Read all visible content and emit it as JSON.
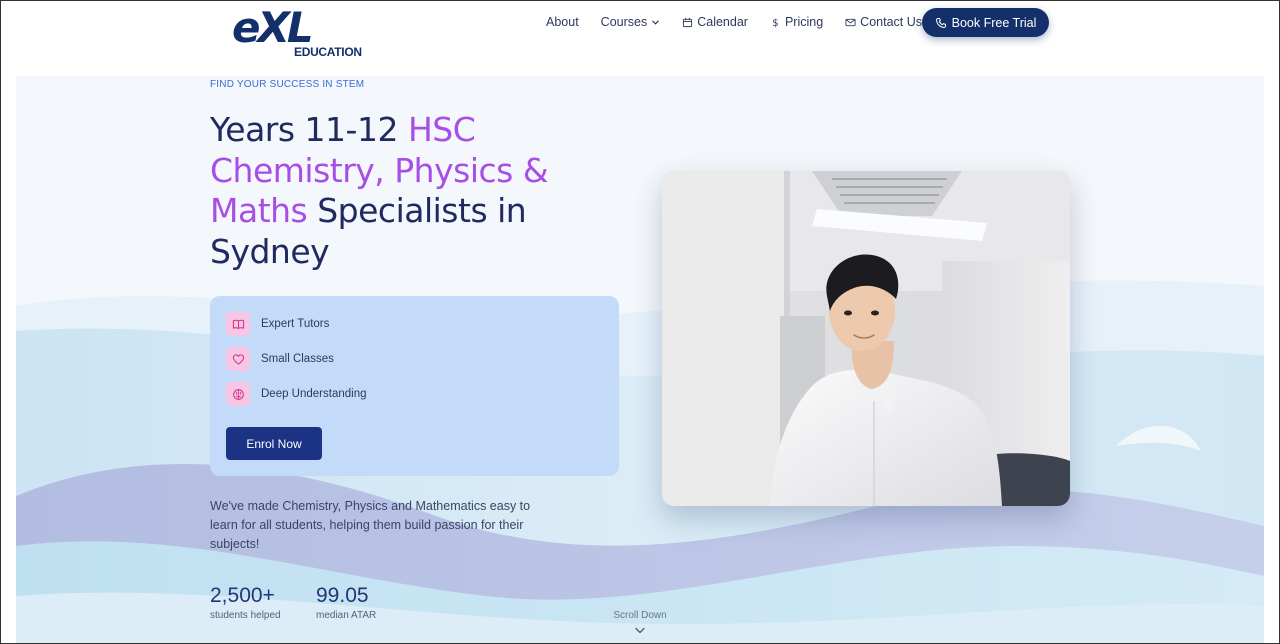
{
  "brand": {
    "logo_mark": "eXL",
    "logo_sub": "EDUCATION"
  },
  "nav": {
    "about": "About",
    "courses": "Courses",
    "calendar": "Calendar",
    "pricing": "Pricing",
    "contact": "Contact Us",
    "cta": "Book Free Trial"
  },
  "hero": {
    "eyebrow": "FIND YOUR SUCCESS IN STEM",
    "headline": {
      "part1": "Years 11-12 ",
      "highlight": "HSC Chemistry, Physics & Maths",
      "part2": " Specialists in Sydney"
    },
    "features": [
      {
        "icon": "book-open-icon",
        "label": "Expert Tutors"
      },
      {
        "icon": "heart-icon",
        "label": "Small Classes"
      },
      {
        "icon": "brain-icon",
        "label": "Deep Understanding"
      }
    ],
    "enrol_label": "Enrol Now",
    "description": "We've made Chemistry, Physics and Mathematics easy to learn for all students, helping them build passion for their subjects!",
    "stats": [
      {
        "value": "2,500+",
        "label": "students helped"
      },
      {
        "value": "99.05",
        "label": "median ATAR"
      }
    ],
    "scroll_label": "Scroll Down"
  },
  "colors": {
    "brand_navy": "#14306b",
    "highlight_purple": "#a64ee6",
    "feature_panel": "#c3daf8",
    "icon_tile_pink": "#f7c6e4"
  }
}
